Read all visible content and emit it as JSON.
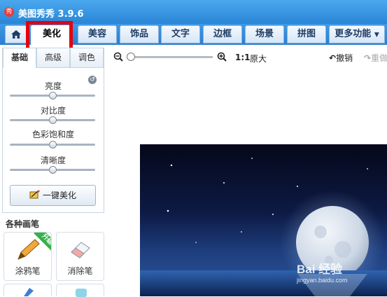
{
  "window": {
    "title": "美图秀秀 3.9.6"
  },
  "tabs": [
    {
      "label": "美化",
      "active": true
    },
    {
      "label": "美容"
    },
    {
      "label": "饰品"
    },
    {
      "label": "文字"
    },
    {
      "label": "边框"
    },
    {
      "label": "场景"
    },
    {
      "label": "拼图"
    },
    {
      "label": "更多功能"
    }
  ],
  "left_panel": {
    "subtabs": [
      "基础",
      "高级",
      "调色"
    ],
    "sliders": [
      {
        "label": "亮度",
        "value": 0.5
      },
      {
        "label": "对比度",
        "value": 0.5
      },
      {
        "label": "色彩饱和度",
        "value": 0.5
      },
      {
        "label": "清晰度",
        "value": 0.5
      }
    ],
    "one_click_label": "一键美化",
    "brushes_header": "各种画笔",
    "brushes": [
      {
        "label": "涂鸦笔",
        "badge": "升级"
      },
      {
        "label": "消除笔"
      }
    ]
  },
  "toolbar": {
    "ratio_label": "1:1",
    "original_label": "原大",
    "undo_label": "撤销",
    "redo_label": "重做",
    "zoom_level": 0.0
  },
  "watermark": {
    "brand": "Bai 经验",
    "url": "jingyan.baidu.com"
  },
  "colors": {
    "accent": "#2b85d3",
    "highlight_box": "#e4000f",
    "upgrade_badge": "#35b04a"
  }
}
